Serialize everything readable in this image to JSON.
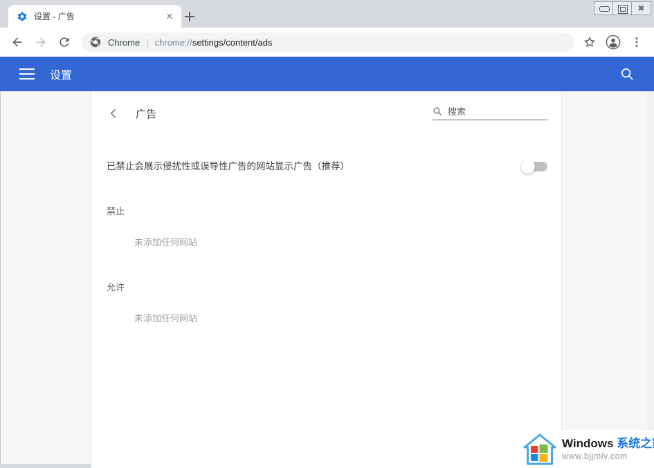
{
  "window": {
    "controls": {
      "minimize": "minimize",
      "maximize": "maximize",
      "close": "close"
    }
  },
  "tabstrip": {
    "tabs": [
      {
        "title": "设置 - 广告",
        "favicon": "gear-icon",
        "close_label": "关闭"
      }
    ],
    "new_tab_label": "新建标签页"
  },
  "toolbar": {
    "back_label": "返回",
    "forward_label": "前进",
    "reload_label": "重新加载",
    "omnibox": {
      "icon": "chrome-icon",
      "scheme_label": "Chrome",
      "separator": "|",
      "url_prefix": "chrome://",
      "url_bold": "settings/content/ads",
      "url_full": "chrome://settings/content/ads"
    },
    "bookmark_label": "为此标签页添加书签",
    "profile_label": "个人资料",
    "menu_label": "自定义及控制 Google Chrome"
  },
  "settings_header": {
    "menu_label": "主菜单",
    "title": "设置",
    "search_label": "搜索设置"
  },
  "content": {
    "back_label": "返回",
    "title": "广告",
    "search": {
      "placeholder": "搜索",
      "value": ""
    },
    "toggle": {
      "label": "已禁止会展示侵扰性或误导性广告的网站显示广告（推荐）",
      "state": "off"
    },
    "sections": [
      {
        "title": "禁止",
        "empty_text": "未添加任何网站"
      },
      {
        "title": "允许",
        "empty_text": "未添加任何网站"
      }
    ]
  },
  "watermark": {
    "logo": "windows-house-icon",
    "brand_en": "Windows ",
    "brand_cn": "系统之家",
    "url": "www.bjjmlv.com"
  },
  "colors": {
    "header_blue": "#3367d6",
    "tab_favicon_blue": "#1a73e8",
    "page_bg": "#f5f6f7",
    "card_bg": "#ffffff",
    "text_primary": "#3c4043",
    "text_secondary": "#5f6368",
    "text_muted": "#9aa0a6",
    "toggle_track_off": "#bdc1c6",
    "watermark_accent": "#1a73e8"
  }
}
